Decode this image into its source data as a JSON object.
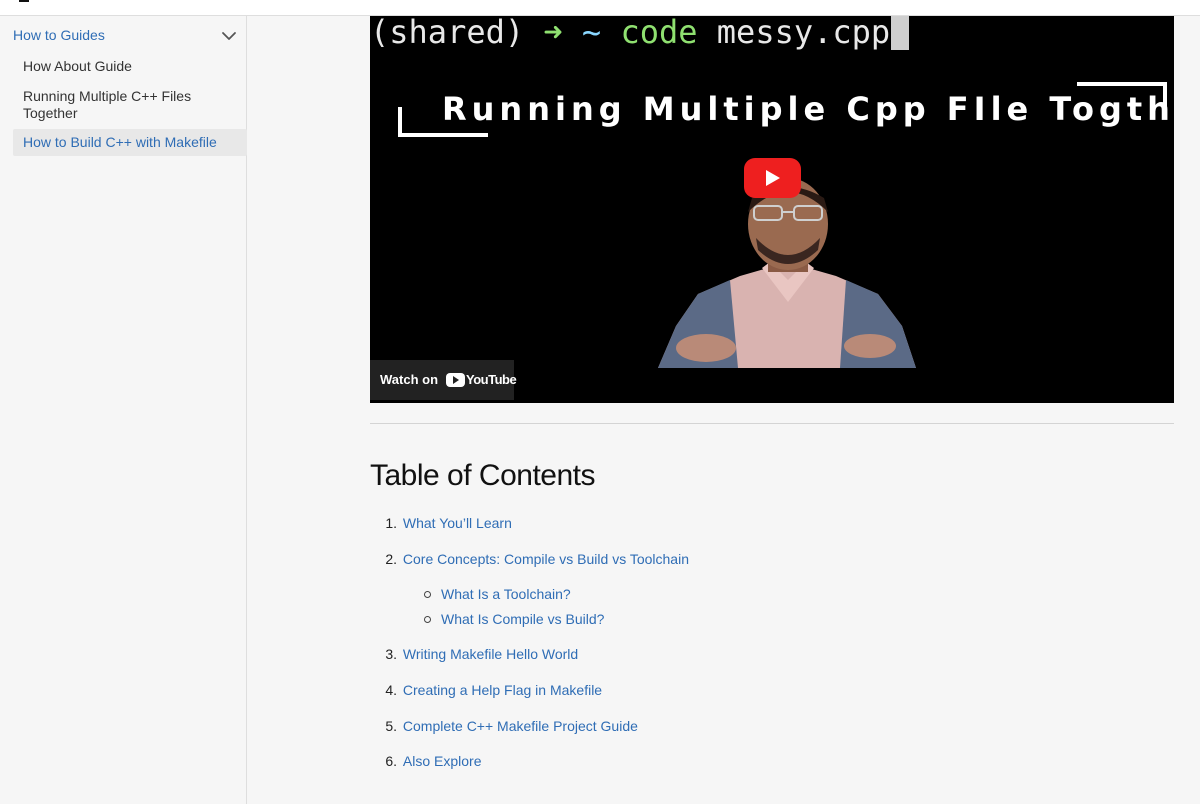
{
  "sidebar": {
    "group_label": "How to Guides",
    "items": [
      {
        "label": "How About Guide"
      },
      {
        "label": "Running Multiple C++ Files Together"
      },
      {
        "label": "How to Build C++ with Makefile"
      }
    ]
  },
  "video": {
    "terminal_prefix": "(shared)",
    "terminal_arrow": "➜",
    "terminal_tilde": "~",
    "terminal_command": "code",
    "terminal_arg": "messy.cpp",
    "title": "Running Multiple Cpp FIle Togther",
    "watch_on_label": "Watch on",
    "youtube_wordmark": "YouTube"
  },
  "toc": {
    "heading": "Table of Contents",
    "items": [
      {
        "num": "1.",
        "label": "What You’ll Learn"
      },
      {
        "num": "2.",
        "label": "Core Concepts: Compile vs Build vs Toolchain"
      },
      {
        "num": "3.",
        "label": "Writing Makefile Hello World"
      },
      {
        "num": "4.",
        "label": "Creating a Help Flag in Makefile"
      },
      {
        "num": "5.",
        "label": "Complete C++ Makefile Project Guide"
      },
      {
        "num": "6.",
        "label": "Also Explore"
      }
    ],
    "subitems": [
      {
        "label": "What Is a Toolchain?"
      },
      {
        "label": "What Is Compile vs Build?"
      }
    ]
  },
  "colors": {
    "link": "#2f6db5",
    "youtube_red": "#ee1f1f",
    "sidebar_active_bg": "#e8e8e8"
  },
  "icons": [
    "chevron-down-icon",
    "play-icon",
    "youtube-logo-icon"
  ]
}
